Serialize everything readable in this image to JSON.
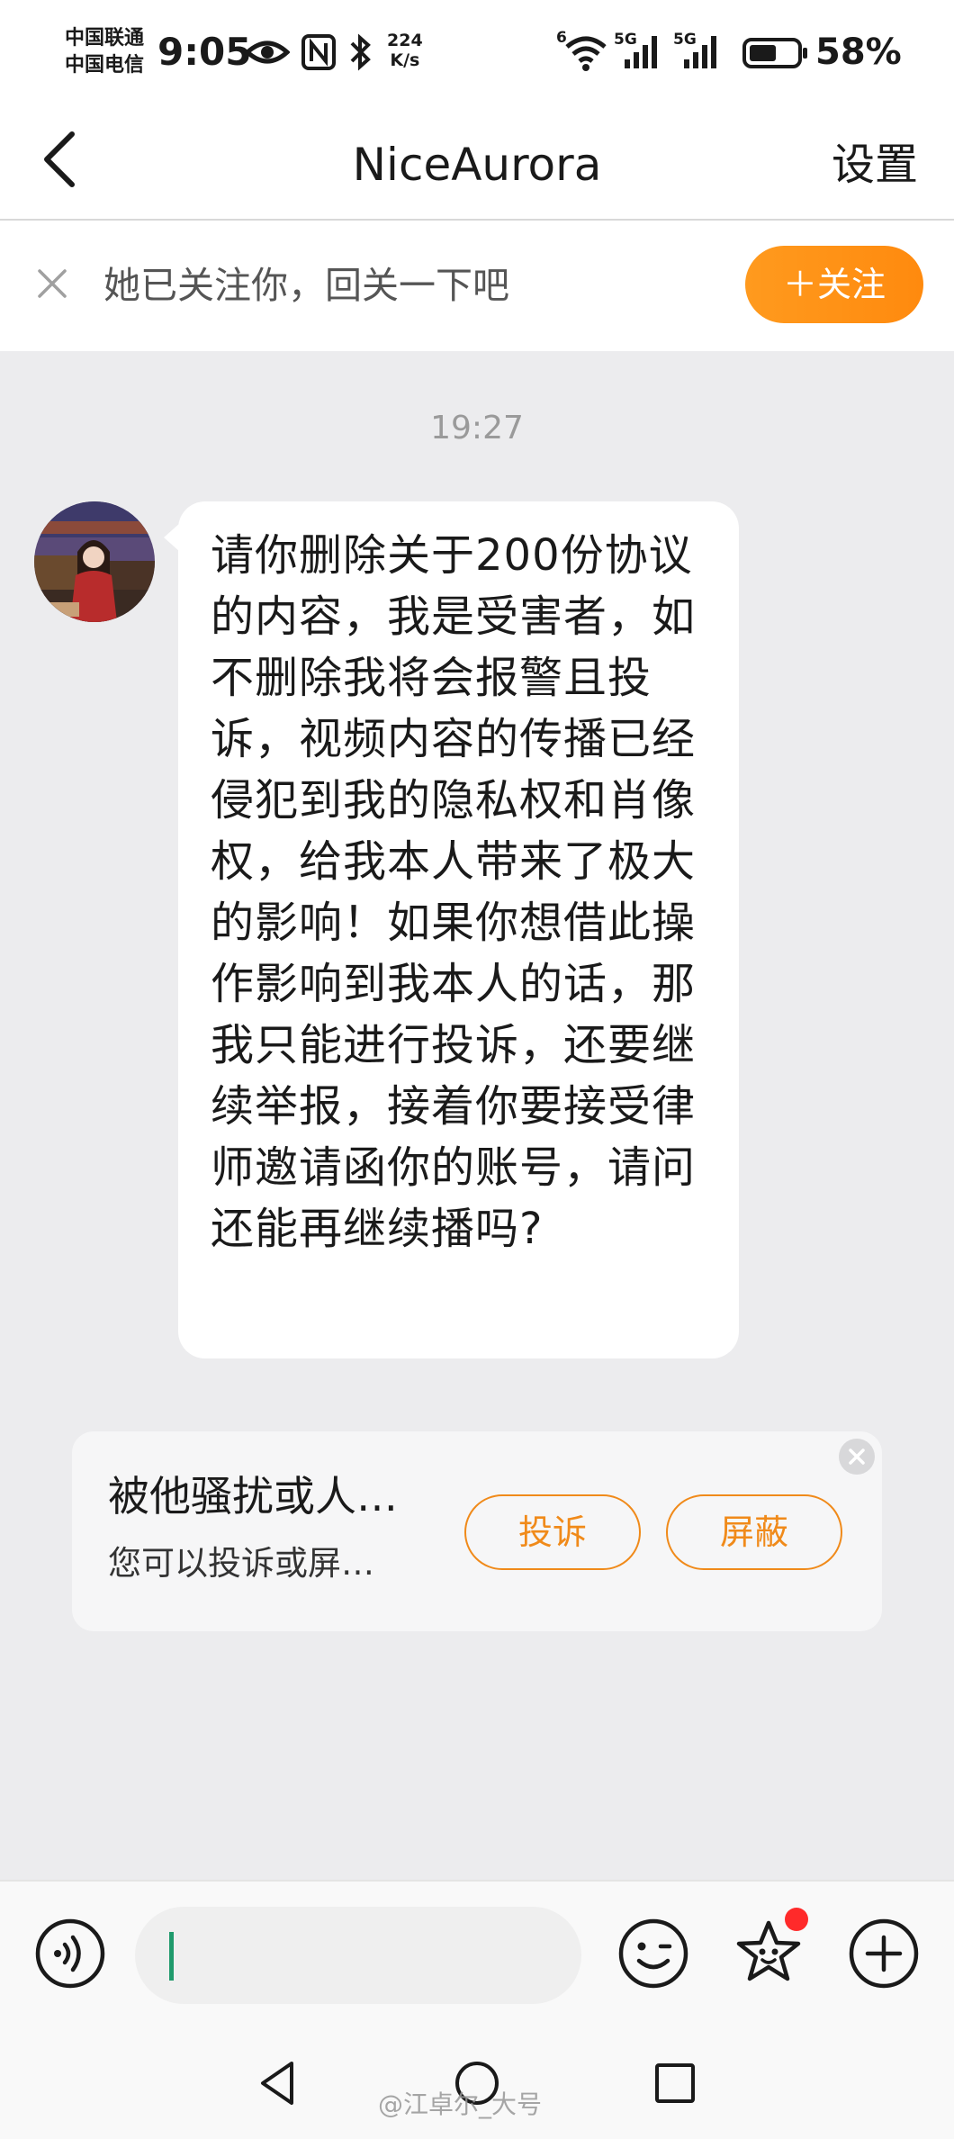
{
  "status_bar": {
    "carrier_1": "中国联通",
    "carrier_2": "中国电信",
    "time": "9:05",
    "net_speed_value": "224",
    "net_speed_unit": "K/s",
    "wifi_label": "6",
    "sim1_label": "5G",
    "sim2_label": "5G",
    "battery_level": 58,
    "battery_percent": "58%"
  },
  "nav": {
    "title": "NiceAurora",
    "settings_label": "设置"
  },
  "follow_banner": {
    "text": "她已关注你，回关一下吧",
    "follow_button": "＋关注"
  },
  "chat": {
    "timestamp": "19:27",
    "message": "请你删除关于200份协议的内容，我是受害者，如不删除我将会报警且投诉，视频内容的传播已经侵犯到我的隐私权和肖像权，给我本人带来了极大的影响！如果你想借此操作影响到我本人的话，那我只能进行投诉，还要继续举报，接着你要接受律师邀请函你的账号，请问还能再继续播吗?"
  },
  "harassment_card": {
    "title": "被他骚扰或人…",
    "subtitle": "您可以投诉或屏…",
    "report_button": "投诉",
    "block_button": "屏蔽"
  },
  "input_bar": {
    "voice_icon": "voice-icon",
    "emoji_icon": "emoji-icon",
    "sticker_icon": "sticker-icon",
    "plus_icon": "plus-icon"
  },
  "watermark": "@江卓尔_大号",
  "colors": {
    "accent": "#ff8a0e",
    "chat_background": "#ececee",
    "notification_dot": "#ff2a2a"
  }
}
